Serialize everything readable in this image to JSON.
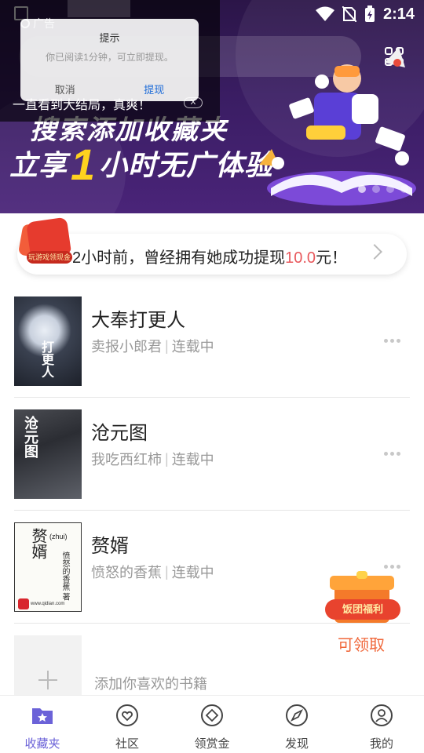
{
  "status_bar": {
    "time": "2:14"
  },
  "ad": {
    "tag": "广告",
    "dialog_title": "提示",
    "dialog_message": "你已阅读1分钟，可立即提现。",
    "cancel_label": "取消",
    "confirm_label": "提现",
    "caption": "一直看到大结局，真爽！",
    "close_label": "X"
  },
  "banner": {
    "line1": "搜索添加收藏夹",
    "line2_prefix": "立享",
    "line2_number": "1",
    "line2_suffix": "小时无广体验",
    "page_count": 4,
    "active_page": 1
  },
  "notice": {
    "badge": "玩游戏领现金",
    "text_prefix": "2小时前，曾经拥有她成功提现",
    "amount": "10.0",
    "text_suffix": "元！"
  },
  "books": [
    {
      "title": "大奉打更人",
      "author": "卖报小郎君",
      "status": "连载中",
      "cover_text": "打更人"
    },
    {
      "title": "沧元图",
      "author": "我吃西红柿",
      "status": "连载中",
      "cover_text": "沧元图"
    },
    {
      "title": "赘婿",
      "author": "愤怒的香蕉",
      "status": "连载中",
      "cover_text": "赘婿",
      "cover_subtext": "(zhui)",
      "cover_author": "愤怒的香蕉 著",
      "cover_site": "www.qidian.com"
    }
  ],
  "add_book": {
    "label": "添加你喜欢的书籍"
  },
  "gift": {
    "badge": "饭团福利",
    "label": "可领取"
  },
  "tabs": [
    {
      "label": "收藏夹",
      "icon": "bookmark-folder-icon",
      "active": true
    },
    {
      "label": "社区",
      "icon": "heart-bubble-icon",
      "active": false
    },
    {
      "label": "领赏金",
      "icon": "diamond-coin-icon",
      "active": false
    },
    {
      "label": "发现",
      "icon": "compass-icon",
      "active": false
    },
    {
      "label": "我的",
      "icon": "user-icon",
      "active": false
    }
  ],
  "colors": {
    "accent": "#6b62d8",
    "highlight_amount": "#e8585c",
    "banner_bg": "#3a1d63",
    "banner_number": "#ffd21f",
    "gift_label": "#f0673a"
  }
}
